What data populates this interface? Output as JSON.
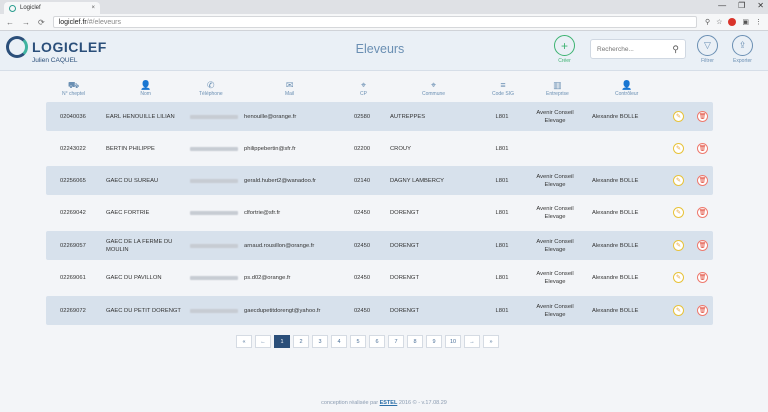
{
  "browser": {
    "tab_title": "Logiclef",
    "tab_close": "×",
    "url_host": "logiclef.fr",
    "url_path": "/#/eleveurs",
    "controls": [
      "—",
      "❐",
      "✕"
    ]
  },
  "header": {
    "brand": "LOGICLEF",
    "user": "Julien CAQUEL",
    "page_title": "Eleveurs",
    "create_label": "Créer",
    "search_placeholder": "Recherche...",
    "filter_label": "Filtrer",
    "export_label": "Exporter"
  },
  "columns": [
    {
      "label": "N° cheptel",
      "icon": "cow-icon",
      "glyph": "⛟"
    },
    {
      "label": "Nom",
      "icon": "person-icon",
      "glyph": "👤"
    },
    {
      "label": "Téléphone",
      "icon": "phone-icon",
      "glyph": "✆"
    },
    {
      "label": "Mail",
      "icon": "envelope-icon",
      "glyph": "✉"
    },
    {
      "label": "CP",
      "icon": "location-pin-icon",
      "glyph": "⌖"
    },
    {
      "label": "Commune",
      "icon": "map-pin-icon",
      "glyph": "⌖"
    },
    {
      "label": "Code SIG",
      "icon": "code-icon",
      "glyph": "≡"
    },
    {
      "label": "Entreprise",
      "icon": "building-icon",
      "glyph": "▥"
    },
    {
      "label": "Contrôleur",
      "icon": "user-icon",
      "glyph": "👤"
    }
  ],
  "rows": [
    {
      "cheptel": "02040036",
      "nom": "EARL HENOUILLE LILIAN",
      "mail": "henouille@orange.fr",
      "cp": "02580",
      "commune": "AUTREPPES",
      "sig": "L801",
      "entreprise": "Avenir Conseil Elevage",
      "controleur": "Alexandre BOLLE"
    },
    {
      "cheptel": "02243022",
      "nom": "BERTIN PHILIPPE",
      "mail": "philippebertin@sfr.fr",
      "cp": "02200",
      "commune": "CROUY",
      "sig": "L801",
      "entreprise": "",
      "controleur": ""
    },
    {
      "cheptel": "02256065",
      "nom": "GAEC DU SUREAU",
      "mail": "gerald.hubert2@wanadoo.fr",
      "cp": "02140",
      "commune": "DAGNY LAMBERCY",
      "sig": "L801",
      "entreprise": "Avenir Conseil Elevage",
      "controleur": "Alexandre BOLLE"
    },
    {
      "cheptel": "02269042",
      "nom": "GAEC FORTRIE",
      "mail": "clfortrie@sfr.fr",
      "cp": "02450",
      "commune": "DORENGT",
      "sig": "L801",
      "entreprise": "Avenir Conseil Elevage",
      "controleur": "Alexandre BOLLE"
    },
    {
      "cheptel": "02269057",
      "nom": "GAEC DE LA FERME DU MOULIN",
      "mail": "arnaud.rousillon@orange.fr",
      "cp": "02450",
      "commune": "DORENGT",
      "sig": "L801",
      "entreprise": "Avenir Conseil Elevage",
      "controleur": "Alexandre BOLLE"
    },
    {
      "cheptel": "02269061",
      "nom": "GAEC DU PAVILLON",
      "mail": "ps.d02@orange.fr",
      "cp": "02450",
      "commune": "DORENGT",
      "sig": "L801",
      "entreprise": "Avenir Conseil Elevage",
      "controleur": "Alexandre BOLLE"
    },
    {
      "cheptel": "02269072",
      "nom": "GAEC DU PETIT DORENGT",
      "mail": "gaecdupetitdorengt@yahoo.fr",
      "cp": "02450",
      "commune": "DORENGT",
      "sig": "L801",
      "entreprise": "Avenir Conseil Elevage",
      "controleur": "Alexandre BOLLE"
    }
  ],
  "pagination": {
    "first": "«",
    "prev": "←",
    "pages": [
      "1",
      "2",
      "3",
      "4",
      "5",
      "6",
      "7",
      "8",
      "9",
      "10"
    ],
    "active": "1",
    "next": "→",
    "last": "»"
  },
  "footer": {
    "prefix": "conception réalisée par",
    "company": "ESTEL",
    "suffix": "2016 © - v.17.08.29"
  },
  "colors": {
    "primary": "#2b4f7a",
    "accent": "#3cb371",
    "row_alt": "#d7e1ec"
  }
}
